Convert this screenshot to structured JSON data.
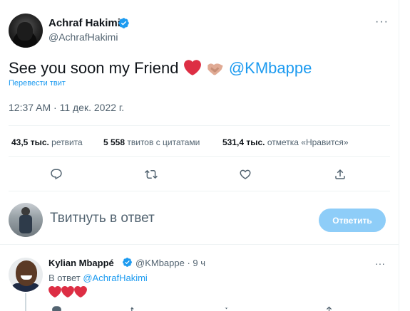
{
  "tweet": {
    "author_name": "Achraf Hakimi",
    "author_handle": "@AchrafHakimi",
    "more_glyph": "···",
    "text_before": "See you soon my Friend",
    "mention": "@KMbappe",
    "emoji_names": [
      "red-heart-emoji",
      "handshake-emoji"
    ],
    "translate_label": "Перевести твит",
    "timestamp": "12:37 AM · 11 дек. 2022 г."
  },
  "stats": {
    "retweets_count": "43,5 тыс.",
    "retweets_label": "ретвита",
    "quotes_count": "5 558",
    "quotes_label": "твитов с цитатами",
    "likes_count": "531,4 тыс.",
    "likes_label": "отметка «Нравится»"
  },
  "actions": [
    "reply-icon",
    "retweet-icon",
    "like-icon",
    "share-icon"
  ],
  "composer": {
    "placeholder": "Твитнуть в ответ",
    "button_label": "Ответить"
  },
  "reply": {
    "author_name": "Kylian Mbappé",
    "author_handle": "@KMbappe · 9 ч",
    "more_glyph": "···",
    "reply_to_label": "В ответ",
    "reply_to_handle": "@AchrafHakimi",
    "emoji_names": [
      "red-heart-emoji",
      "red-heart-emoji",
      "red-heart-emoji"
    ]
  },
  "colors": {
    "accent": "#1d9bf0",
    "reply_button_bg": "#8ecdf8",
    "text_secondary": "#536471",
    "divider": "#eff3f4",
    "heart": "#e0245e"
  }
}
